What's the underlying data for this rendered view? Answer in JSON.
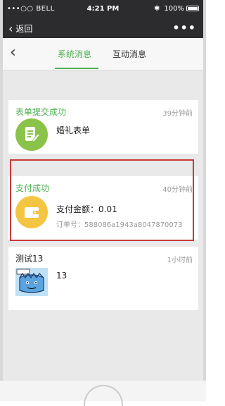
{
  "status": {
    "carrier": "•••○○ BELL",
    "time": "4:21 PM",
    "battery": "100%"
  },
  "nav": {
    "back_label": "返回",
    "more_label": "•••"
  },
  "tabs": {
    "system": "系统消息",
    "interactive": "互动消息"
  },
  "messages": [
    {
      "title": "表单提交成功",
      "time": "39分钟前",
      "text": "婚礼表单",
      "title_color": "#4caf50",
      "icon_color": "#8bc34a",
      "icon": "document-edit-icon"
    },
    {
      "title": "支付成功",
      "time": "40分钟前",
      "text": "支付金额：0.01",
      "sub": "订单号：588086a1943a8047870073",
      "title_color": "#4caf50",
      "icon_color": "#f4c542",
      "icon": "wallet-icon"
    },
    {
      "title": "测试13",
      "time": "1小时前",
      "text": "13",
      "title_color": "#222222",
      "icon": "comic-thumbnail"
    }
  ]
}
